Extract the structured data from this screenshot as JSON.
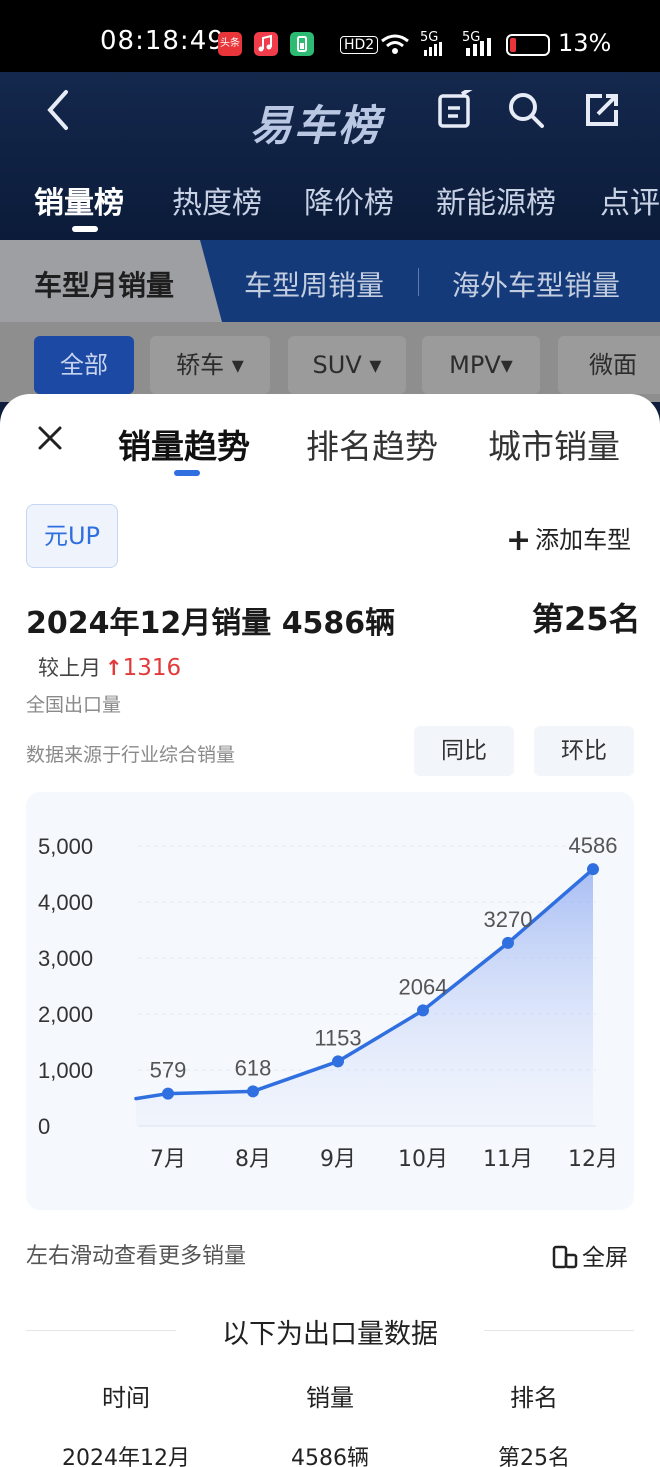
{
  "status_bar": {
    "time": "08:18:49",
    "toutiao_label": "头条",
    "network_hd": "HD2",
    "network_5g_1": "5G",
    "network_5g_2": "5G",
    "battery": "13%"
  },
  "header": {
    "brand": "易车榜",
    "tabs": [
      "销量榜",
      "热度榜",
      "降价榜",
      "新能源榜",
      "点评"
    ]
  },
  "sub_tabs": [
    "车型月销量",
    "车型周销量",
    "海外车型销量"
  ],
  "filter_chips": [
    "全部",
    "轿车",
    "SUV",
    "MPV",
    "微面"
  ],
  "sheet": {
    "tabs": [
      "销量趋势",
      "排名趋势",
      "城市销量"
    ],
    "model": "元UP",
    "add_model": "添加车型",
    "headline": "2024年12月销量  4586辆",
    "rank": "第25名",
    "mom_label": "较上月",
    "mom_delta": "1316",
    "scope": "全国出口量",
    "source": "数据来源于行业综合销量",
    "compare_buttons": [
      "同比",
      "环比"
    ],
    "swipe_hint": "左右滑动查看更多销量",
    "fullscreen": "全屏",
    "table_title": "以下为出口量数据",
    "table_headers": [
      "时间",
      "销量",
      "排名"
    ],
    "table_rows": [
      [
        "2024年12月",
        "4586辆",
        "第25名"
      ]
    ]
  },
  "chart_data": {
    "type": "area",
    "categories": [
      "7月",
      "8月",
      "9月",
      "10月",
      "11月",
      "12月"
    ],
    "values": [
      579,
      618,
      1153,
      2064,
      3270,
      4586
    ],
    "ylim": [
      0,
      5000
    ],
    "yticks": [
      "0",
      "1,000",
      "2,000",
      "3,000",
      "4,000",
      "5,000"
    ],
    "grid": true,
    "color": "#2f6fe0"
  }
}
